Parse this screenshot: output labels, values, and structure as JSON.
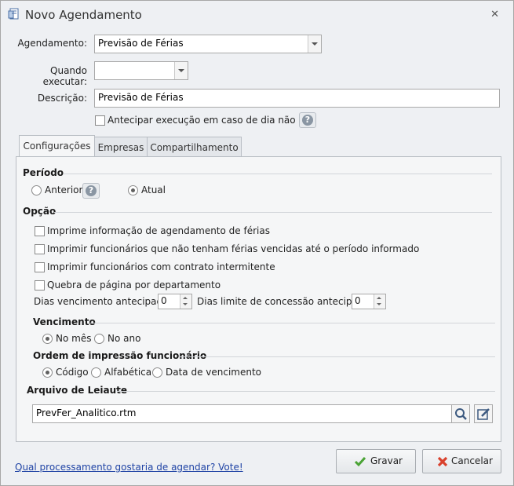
{
  "window": {
    "title": "Novo Agendamento",
    "close_glyph": "✕"
  },
  "form": {
    "agendamento_label": "Agendamento:",
    "agendamento_value": "Previsão de Férias",
    "quando_label": "Quando executar:",
    "quando_value": "",
    "descricao_label": "Descrição:",
    "descricao_value": "Previsão de Férias",
    "antecipar_label": "Antecipar execução em caso de dia não útil.",
    "antecipar_checked": false
  },
  "tabs": [
    {
      "label": "Configurações",
      "active": true
    },
    {
      "label": "Empresas",
      "active": false
    },
    {
      "label": "Compartilhamento",
      "active": false
    }
  ],
  "periodo": {
    "title": "Período",
    "anterior_label": "Anterior",
    "atual_label": "Atual",
    "selected": "Atual"
  },
  "opcao": {
    "title": "Opção",
    "checkboxes": [
      {
        "label": "Imprime informação de agendamento de férias",
        "checked": false
      },
      {
        "label": "Imprimir funcionários que não tenham férias vencidas até o período informado",
        "checked": false
      },
      {
        "label": "Imprimir funcionários com contrato intermitente",
        "checked": false
      },
      {
        "label": "Quebra de página por departamento",
        "checked": false
      }
    ],
    "dias_venc_label": "Dias vencimento antecipado:",
    "dias_venc_value": "0",
    "dias_limite_label": "Dias limite de concessão antecipado:",
    "dias_limite_value": "0"
  },
  "vencimento": {
    "title": "Vencimento",
    "no_mes_label": "No mês",
    "no_ano_label": "No ano",
    "selected": "No mês"
  },
  "ordem": {
    "title": "Ordem de impressão funcionário",
    "codigo_label": "Código",
    "alfabetica_label": "Alfabética",
    "data_venc_label": "Data de vencimento",
    "selected": "Código"
  },
  "arquivo": {
    "title": "Arquivo de Leiaute",
    "value": "PrevFer_Analitico.rtm"
  },
  "footer": {
    "link_text": "Qual processamento gostaria de agendar? Vote!",
    "gravar_label": "Gravar",
    "cancelar_label": "Cancelar"
  },
  "colors": {
    "link": "#2044a5",
    "gravar_icon": "#4aa335",
    "cancelar_icon": "#d9412c"
  }
}
